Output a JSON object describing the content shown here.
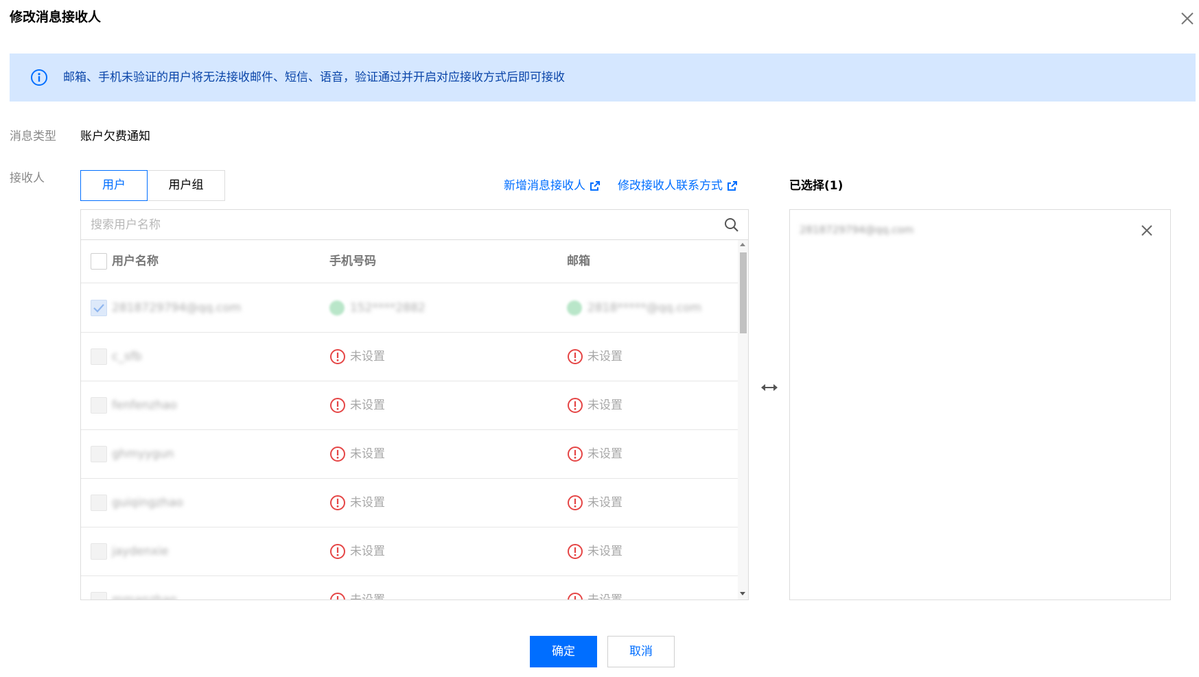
{
  "dialog": {
    "title": "修改消息接收人"
  },
  "alert": {
    "text": "邮箱、手机未验证的用户将无法接收邮件、短信、语音，验证通过并开启对应接收方式后即可接收"
  },
  "form": {
    "message_type_label": "消息类型",
    "message_type_value": "账户欠费通知",
    "recipient_label": "接收人"
  },
  "tabs": [
    {
      "label": "用户",
      "active": true
    },
    {
      "label": "用户组",
      "active": false
    }
  ],
  "links": {
    "add_recipient": "新增消息接收人",
    "edit_contact": "修改接收人联系方式"
  },
  "search": {
    "placeholder": "搜索用户名称"
  },
  "table": {
    "columns": [
      "用户名称",
      "手机号码",
      "邮箱"
    ],
    "rows": [
      {
        "name": "2818729794@qq.com",
        "phone": "152****2882",
        "email": "2818*****@qq.com",
        "checked": true,
        "verified": true
      },
      {
        "name": "c_sfb",
        "phone": "未设置",
        "email": "未设置",
        "checked": false,
        "verified": false
      },
      {
        "name": "fenfenzhao",
        "phone": "未设置",
        "email": "未设置",
        "checked": false,
        "verified": false
      },
      {
        "name": "ghmyygun",
        "phone": "未设置",
        "email": "未设置",
        "checked": false,
        "verified": false
      },
      {
        "name": "guiqingzhao",
        "phone": "未设置",
        "email": "未设置",
        "checked": false,
        "verified": false
      },
      {
        "name": "jaydenxie",
        "phone": "未设置",
        "email": "未设置",
        "checked": false,
        "verified": false
      },
      {
        "name": "mmanzhan",
        "phone": "未设置",
        "email": "未设置",
        "checked": false,
        "verified": false
      }
    ]
  },
  "selected": {
    "title": "已选择(1)",
    "items": [
      "2818729794@qq.com"
    ]
  },
  "footer": {
    "confirm": "确定",
    "cancel": "取消"
  },
  "colors": {
    "primary": "#006eff",
    "alert_bg": "#d5e7ff",
    "alert_text": "#0a45a8",
    "warning": "#e54545",
    "success": "#b9e6c9"
  }
}
